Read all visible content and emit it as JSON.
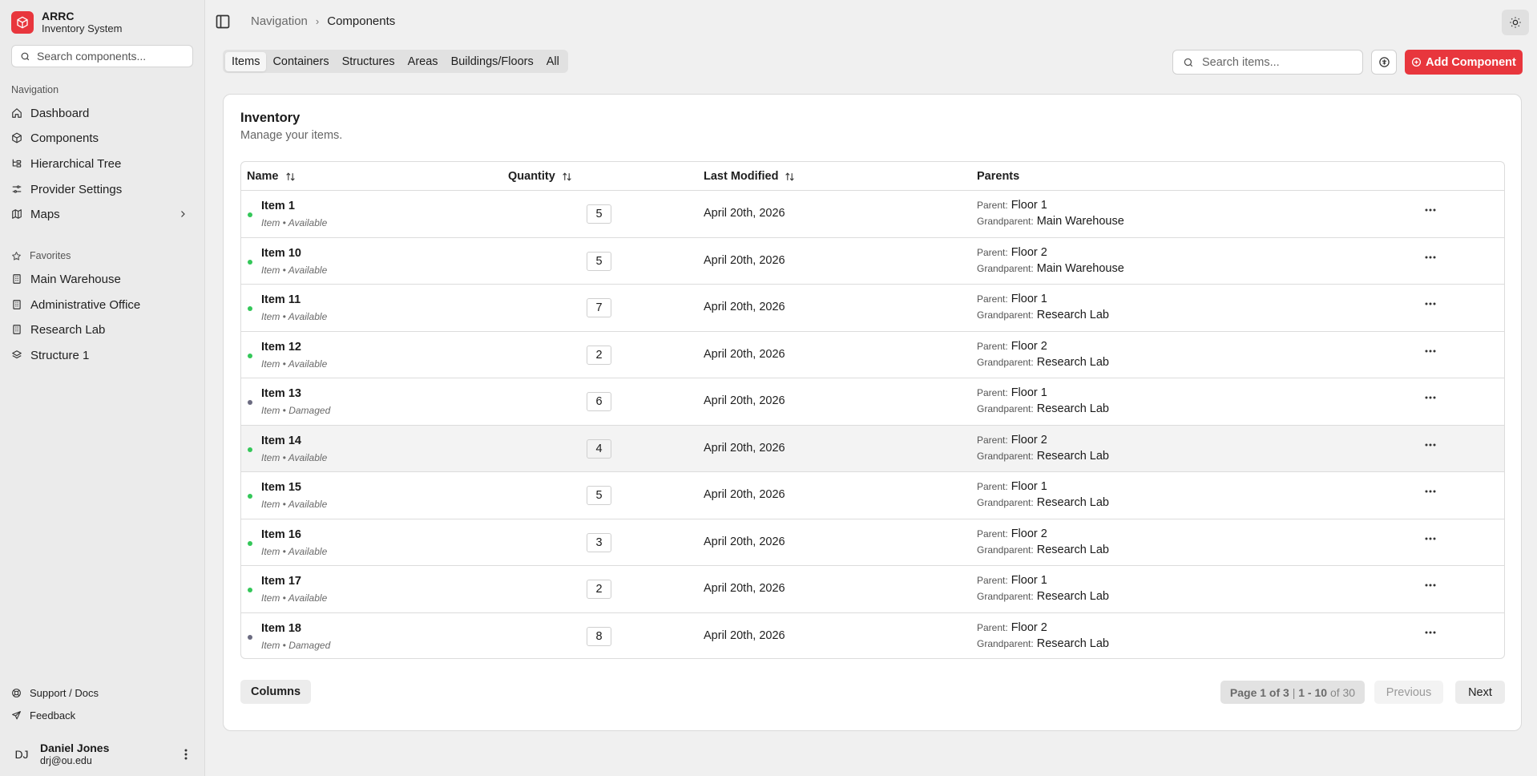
{
  "brand": {
    "title": "ARRC",
    "subtitle": "Inventory System",
    "icon": "package-icon"
  },
  "sidebar": {
    "search_placeholder": "Search components...",
    "nav_label": "Navigation",
    "nav_items": [
      {
        "label": "Dashboard",
        "icon": "home-icon"
      },
      {
        "label": "Components",
        "icon": "box-icon"
      },
      {
        "label": "Hierarchical Tree",
        "icon": "tree-icon"
      },
      {
        "label": "Provider Settings",
        "icon": "sliders-icon"
      },
      {
        "label": "Maps",
        "icon": "map-icon"
      }
    ],
    "favorites_label": "Favorites",
    "favorites": [
      {
        "label": "Main Warehouse",
        "icon": "building-icon"
      },
      {
        "label": "Administrative Office",
        "icon": "building-icon"
      },
      {
        "label": "Research Lab",
        "icon": "building-icon"
      },
      {
        "label": "Structure 1",
        "icon": "layers-icon"
      }
    ],
    "footer": [
      {
        "label": "Support / Docs",
        "icon": "lifebuoy-icon"
      },
      {
        "label": "Feedback",
        "icon": "send-icon"
      }
    ],
    "user": {
      "initials": "DJ",
      "name": "Daniel Jones",
      "email": "drj@ou.edu"
    }
  },
  "header": {
    "breadcrumb": [
      "Navigation",
      "Components"
    ]
  },
  "tabs": [
    {
      "label": "Items",
      "active": true
    },
    {
      "label": "Containers",
      "active": false
    },
    {
      "label": "Structures",
      "active": false
    },
    {
      "label": "Areas",
      "active": false
    },
    {
      "label": "Buildings/Floors",
      "active": false
    },
    {
      "label": "All",
      "active": false
    }
  ],
  "toolbar": {
    "search_placeholder": "Search items...",
    "add_label": "Add Component"
  },
  "colors": {
    "brand": "#e8363d",
    "available": "#34c759",
    "damaged": "#6b6b80"
  },
  "card": {
    "title": "Inventory",
    "description": "Manage your items."
  },
  "table": {
    "headers": {
      "name": "Name",
      "quantity": "Quantity",
      "modified": "Last Modified",
      "parents": "Parents"
    },
    "parent_label": "Parent:",
    "grandparent_label": "Grandparent:",
    "rows": [
      {
        "name": "Item 1",
        "subtitle": "Item • Available",
        "status": "available",
        "quantity": "5",
        "modified": "April 20th, 2026",
        "parent": "Floor 1",
        "grandparent": "Main Warehouse"
      },
      {
        "name": "Item 10",
        "subtitle": "Item • Available",
        "status": "available",
        "quantity": "5",
        "modified": "April 20th, 2026",
        "parent": "Floor 2",
        "grandparent": "Main Warehouse"
      },
      {
        "name": "Item 11",
        "subtitle": "Item • Available",
        "status": "available",
        "quantity": "7",
        "modified": "April 20th, 2026",
        "parent": "Floor 1",
        "grandparent": "Research Lab"
      },
      {
        "name": "Item 12",
        "subtitle": "Item • Available",
        "status": "available",
        "quantity": "2",
        "modified": "April 20th, 2026",
        "parent": "Floor 2",
        "grandparent": "Research Lab"
      },
      {
        "name": "Item 13",
        "subtitle": "Item • Damaged",
        "status": "damaged",
        "quantity": "6",
        "modified": "April 20th, 2026",
        "parent": "Floor 1",
        "grandparent": "Research Lab"
      },
      {
        "name": "Item 14",
        "subtitle": "Item • Available",
        "status": "available",
        "quantity": "4",
        "modified": "April 20th, 2026",
        "parent": "Floor 2",
        "grandparent": "Research Lab",
        "highlighted": true
      },
      {
        "name": "Item 15",
        "subtitle": "Item • Available",
        "status": "available",
        "quantity": "5",
        "modified": "April 20th, 2026",
        "parent": "Floor 1",
        "grandparent": "Research Lab"
      },
      {
        "name": "Item 16",
        "subtitle": "Item • Available",
        "status": "available",
        "quantity": "3",
        "modified": "April 20th, 2026",
        "parent": "Floor 2",
        "grandparent": "Research Lab"
      },
      {
        "name": "Item 17",
        "subtitle": "Item • Available",
        "status": "available",
        "quantity": "2",
        "modified": "April 20th, 2026",
        "parent": "Floor 1",
        "grandparent": "Research Lab"
      },
      {
        "name": "Item 18",
        "subtitle": "Item • Damaged",
        "status": "damaged",
        "quantity": "8",
        "modified": "April 20th, 2026",
        "parent": "Floor 2",
        "grandparent": "Research Lab"
      }
    ]
  },
  "pagination": {
    "columns_label": "Columns",
    "page_text": "Page 1 of 3",
    "separator": "|",
    "range_text": "1 - 10",
    "of_text": "of 30",
    "previous_label": "Previous",
    "next_label": "Next"
  }
}
